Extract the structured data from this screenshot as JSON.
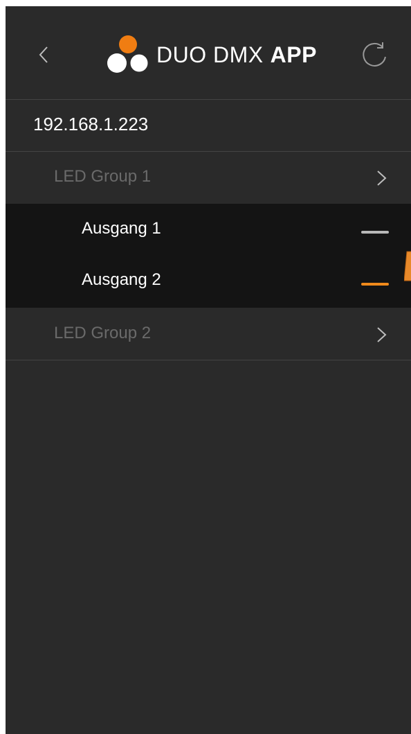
{
  "header": {
    "app_name_regular": "DUO DMX",
    "app_name_bold": "APP",
    "back_icon": "chevron-left-icon",
    "refresh_icon": "refresh-icon"
  },
  "device": {
    "ip": "192.168.1.223"
  },
  "groups": [
    {
      "label": "LED Group 1",
      "expanded": true
    },
    {
      "label": "LED Group 2",
      "expanded": false
    }
  ],
  "outputs": [
    {
      "label": "Ausgang 1",
      "indicator_color": "#b8b8b8"
    },
    {
      "label": "Ausgang 2",
      "indicator_color": "#f08a1c"
    }
  ],
  "colors": {
    "background": "#2a2a2a",
    "expanded_background": "#141414",
    "accent": "#f08a1c",
    "divider": "#444444"
  }
}
